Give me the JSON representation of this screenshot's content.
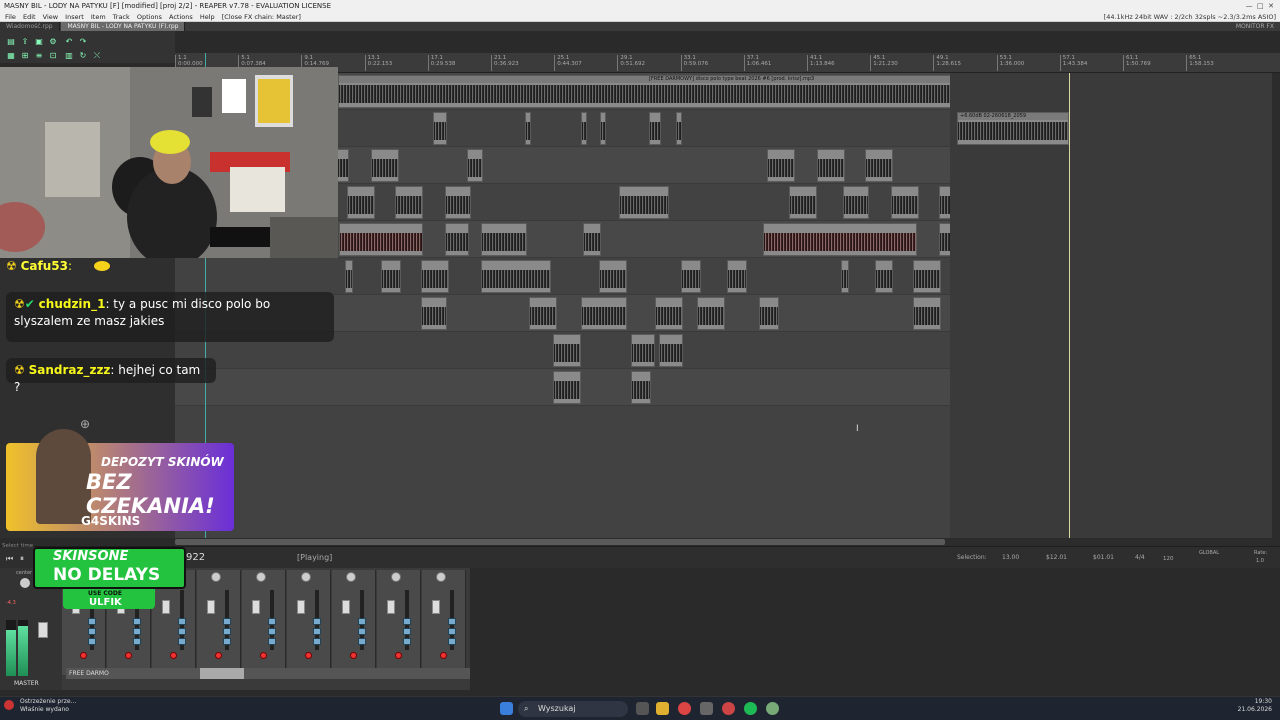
{
  "window": {
    "title": "MASNY BIL - LODY NA PATYKU [F] [modified] [proj 2/2] - REAPER v7.78 - EVALUATION LICENSE",
    "title_right": "[Close FX chain: Master]",
    "audio_status": "[44.1kHz 24bit WAV : 2/2ch 32spls ~2.3/3.2ms ASIO]",
    "monitor_label": "MONITOR FX"
  },
  "menu": {
    "items": [
      "File",
      "Edit",
      "View",
      "Insert",
      "Item",
      "Track",
      "Options",
      "Actions",
      "Help"
    ],
    "extra": "[Close FX chain: Master]"
  },
  "project_tabs": [
    "Wiadomość.rpp",
    "MASNY BIL - LODY NA PATYKU (F).rpp"
  ],
  "ruler": {
    "marks": [
      "1.1",
      "5.1",
      "9.1",
      "13.1",
      "17.1",
      "21.1",
      "25.1",
      "29.1",
      "33.1",
      "37.1",
      "41.1",
      "45.1",
      "49.1",
      "53.1",
      "57.1",
      "61.1",
      "65.1"
    ],
    "times": [
      "0:00.000",
      "0:07.384",
      "0:14.769",
      "0:22.153",
      "0:29.538",
      "0:36.923",
      "0:44.307",
      "0:51.692",
      "0:59.076",
      "1:06.461",
      "1:13.846",
      "1:21.230",
      "1:28.615",
      "1:36.000",
      "1:43.384",
      "1:50.769",
      "1:58.153"
    ]
  },
  "tracks": {
    "item_label_prefix": "M",
    "beat_item": "[FREE DARMOWY] disco polo type beat 2026 #6 [prod. krisz].mp3",
    "beat_item_left": "prod. krisz].mp3",
    "vocal_item": "+6.60dB 02-260618_2059"
  },
  "transport": {
    "state": "[Playing]",
    "position": "922",
    "selection_label": "Selection:",
    "selection_start": "13.00",
    "selection_end": "$12.01",
    "selection_len": "$01.01",
    "time_sig": "4/4",
    "bpm": "120",
    "rate_label": "Rate:",
    "rate_value": "1.0",
    "global_label": "GLOBAL",
    "status_bar": "Select time"
  },
  "mixer": {
    "master_label": "MASTER",
    "center_label": "center",
    "track_name": "FREE DARMO",
    "master_db": "-4.3",
    "strips": 9
  },
  "chat": [
    {
      "user": "Cafu53",
      "text": ""
    },
    {
      "user": "chudzin_1",
      "text": ": ty a pusc mi disco polo bo slyszalem ze masz jakies"
    },
    {
      "user": "Sandraz_zzz",
      "text": ": hejhej co tam ?"
    }
  ],
  "ads": {
    "ad1_line1": "DEPOZYT SKINÓW",
    "ad1_line2": "BEZ CZEKANIA!",
    "ad1_brand": "G4SKINS",
    "ad2_brand": "SKINSONE",
    "ad2_tagline": "NO DELAYS",
    "ad2_code_label": "USE CODE",
    "ad2_code": "ULFIK"
  },
  "taskbar": {
    "search_placeholder": "Wyszukaj",
    "notification_title": "Ostrzeżenie prze...",
    "notification_sub": "Właśnie wydano",
    "time": "19:30",
    "date": "21.06.2026"
  },
  "colors": {
    "accent_green": "#2bd46a",
    "record_red": "#e33333",
    "item_gray": "#8a8a8a",
    "ad_yellow": "#f7d21a",
    "ad_purple": "#5a2fd0"
  }
}
